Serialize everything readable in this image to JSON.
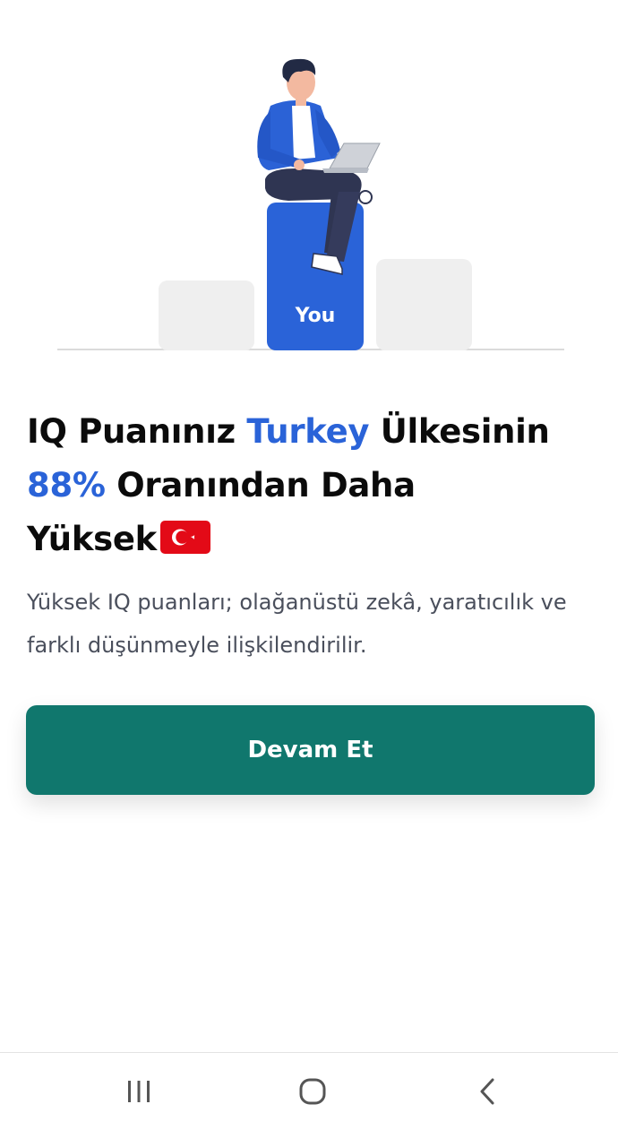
{
  "illustration": {
    "highlight_label": "You",
    "accent_color": "#2A63D8",
    "bar_color": "#EFEFEF"
  },
  "headline": {
    "part1": "IQ Puanınız ",
    "country": "Turkey",
    "part2": " Ülkesinin",
    "percent": "88%",
    "part3": " Oranından Daha",
    "part4": "Yüksek",
    "flag_icon": "turkey-flag-icon"
  },
  "description": "Yüksek IQ puanları; olağanüstü zekâ, yaratıcılık ve farklı düşünmeyle ilişkilendirilir.",
  "cta": {
    "label": "Devam Et",
    "color": "#10776D"
  },
  "system_nav": {
    "recents_icon": "recents-icon",
    "home_icon": "home-icon",
    "back_icon": "back-icon"
  }
}
